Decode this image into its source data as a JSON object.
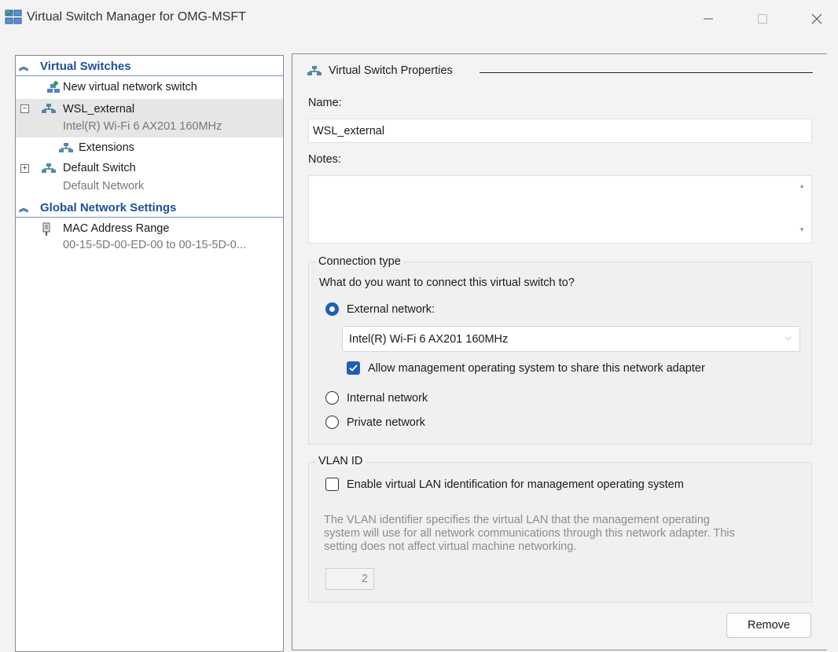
{
  "window": {
    "title": "Virtual Switch Manager for OMG-MSFT",
    "controls": [
      "minimize-icon",
      "maximize-icon",
      "close-icon"
    ]
  },
  "tree": {
    "virtual_switches_header": "Virtual Switches",
    "new_switch": "New virtual network switch",
    "wsl": {
      "name": "WSL_external",
      "adapter": "Intel(R) Wi-Fi 6 AX201 160MHz",
      "expander": "−"
    },
    "extensions": "Extensions",
    "default_switch": {
      "name": "Default Switch",
      "network": "Default Network",
      "expander": "+"
    },
    "global_header": "Global Network Settings",
    "mac": {
      "name": "MAC Address Range",
      "range": "00-15-5D-00-ED-00 to 00-15-5D-0..."
    }
  },
  "properties": {
    "header": "Virtual Switch Properties",
    "name_label": "Name:",
    "name_value": "WSL_external",
    "notes_label": "Notes:",
    "notes_value": "",
    "connection_type": {
      "title": "Connection type",
      "question": "What do you want to connect this virtual switch to?",
      "external": "External network:",
      "adapter_selected": "Intel(R) Wi-Fi 6 AX201 160MHz",
      "allow_mgmt": "Allow management operating system to share this network adapter",
      "allow_mgmt_checked": true,
      "internal": "Internal network",
      "private": "Private network",
      "selected": "external"
    },
    "vlan": {
      "title": "VLAN ID",
      "enable": "Enable virtual LAN identification for management operating system",
      "enabled": false,
      "desc_lines": [
        "The VLAN identifier specifies the virtual LAN that the management operating",
        "system will use for all network communications through this network adapter. This",
        "setting does not affect virtual machine networking."
      ],
      "value": "2"
    },
    "remove_button": "Remove"
  },
  "colors": {
    "accent": "#1d5fb4",
    "section_header": "#1d4f9c"
  }
}
